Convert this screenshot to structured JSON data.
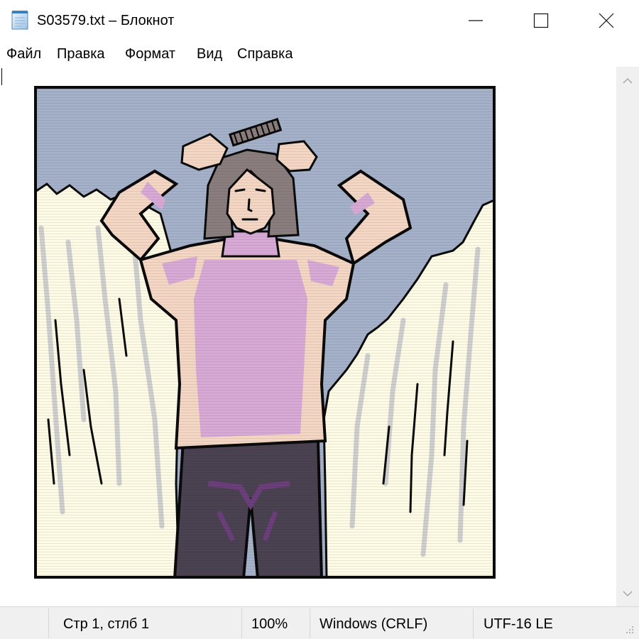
{
  "window": {
    "title": "S03579.txt – Блокнот",
    "icon": "notepad-icon",
    "controls": [
      "minimize-icon",
      "maximize-icon",
      "close-icon"
    ]
  },
  "menu": {
    "items": [
      "Файл",
      "Правка",
      "Формат",
      "Вид",
      "Справка"
    ]
  },
  "editor": {
    "content": "clip-art illustration of a woman combing her hair with a comb, standing between snowy cliffs",
    "colors": {
      "sky": "#a5b1c9",
      "snow": "#fdfbe6",
      "snow_shadow": "#cfcfcf",
      "sweater": "#f3d6c3",
      "sweater_accent": "#d7aad6",
      "hair": "#8a7d7d",
      "pants": "#4a4250",
      "pants_accent": "#6a3f7a",
      "outline": "#0a0a0a"
    }
  },
  "status": {
    "position": "Стр 1, стлб 1",
    "zoom": "100%",
    "line_ending": "Windows (CRLF)",
    "encoding": "UTF-16 LE"
  }
}
